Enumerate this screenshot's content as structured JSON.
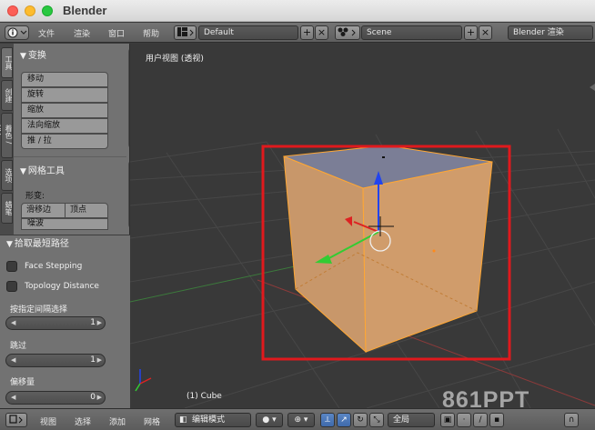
{
  "window": {
    "title": "Blender"
  },
  "info_header": {
    "menus": [
      "文件",
      "渲染",
      "窗口",
      "帮助"
    ],
    "screen_layout": "Default",
    "scene": "Scene",
    "render_engine": "Blender 渲染"
  },
  "side_tabs": [
    "工具",
    "创建",
    "着色 / UV",
    "选项",
    "蜡笔"
  ],
  "tool_shelf": {
    "transform_panel": {
      "title": "变换",
      "buttons": [
        "移动",
        "旋转",
        "缩放",
        "法向缩放",
        "推 / 拉"
      ]
    },
    "mesh_tools_panel": {
      "title": "网格工具",
      "deform_label": "形变:",
      "slide_edge": "滑移边",
      "vertex": "顶点",
      "noise": "噪波"
    }
  },
  "operator_panel": {
    "title": "拾取最短路径",
    "checkboxes": [
      "Face Stepping",
      "Topology Distance"
    ],
    "fields": [
      {
        "label": "按指定间隔选择",
        "value": "1"
      },
      {
        "label": "跳过",
        "value": "1"
      },
      {
        "label": "偏移量",
        "value": "0"
      }
    ]
  },
  "viewport": {
    "view_name": "用户视图 (透视)",
    "object_info": "(1) Cube"
  },
  "bottom_header": {
    "menus": [
      "视图",
      "选择",
      "添加",
      "网格"
    ],
    "mode": "编辑模式",
    "pivot": "全局"
  },
  "watermark": "861PPT",
  "colors": {
    "face_fill": "#cc9966",
    "edge_selected": "#ffaa33",
    "top_face": "#7c7f96",
    "highlight_box": "#e0191d",
    "axis_x": "#dd2222",
    "axis_y": "#33cc33",
    "axis_z": "#2244ee"
  }
}
